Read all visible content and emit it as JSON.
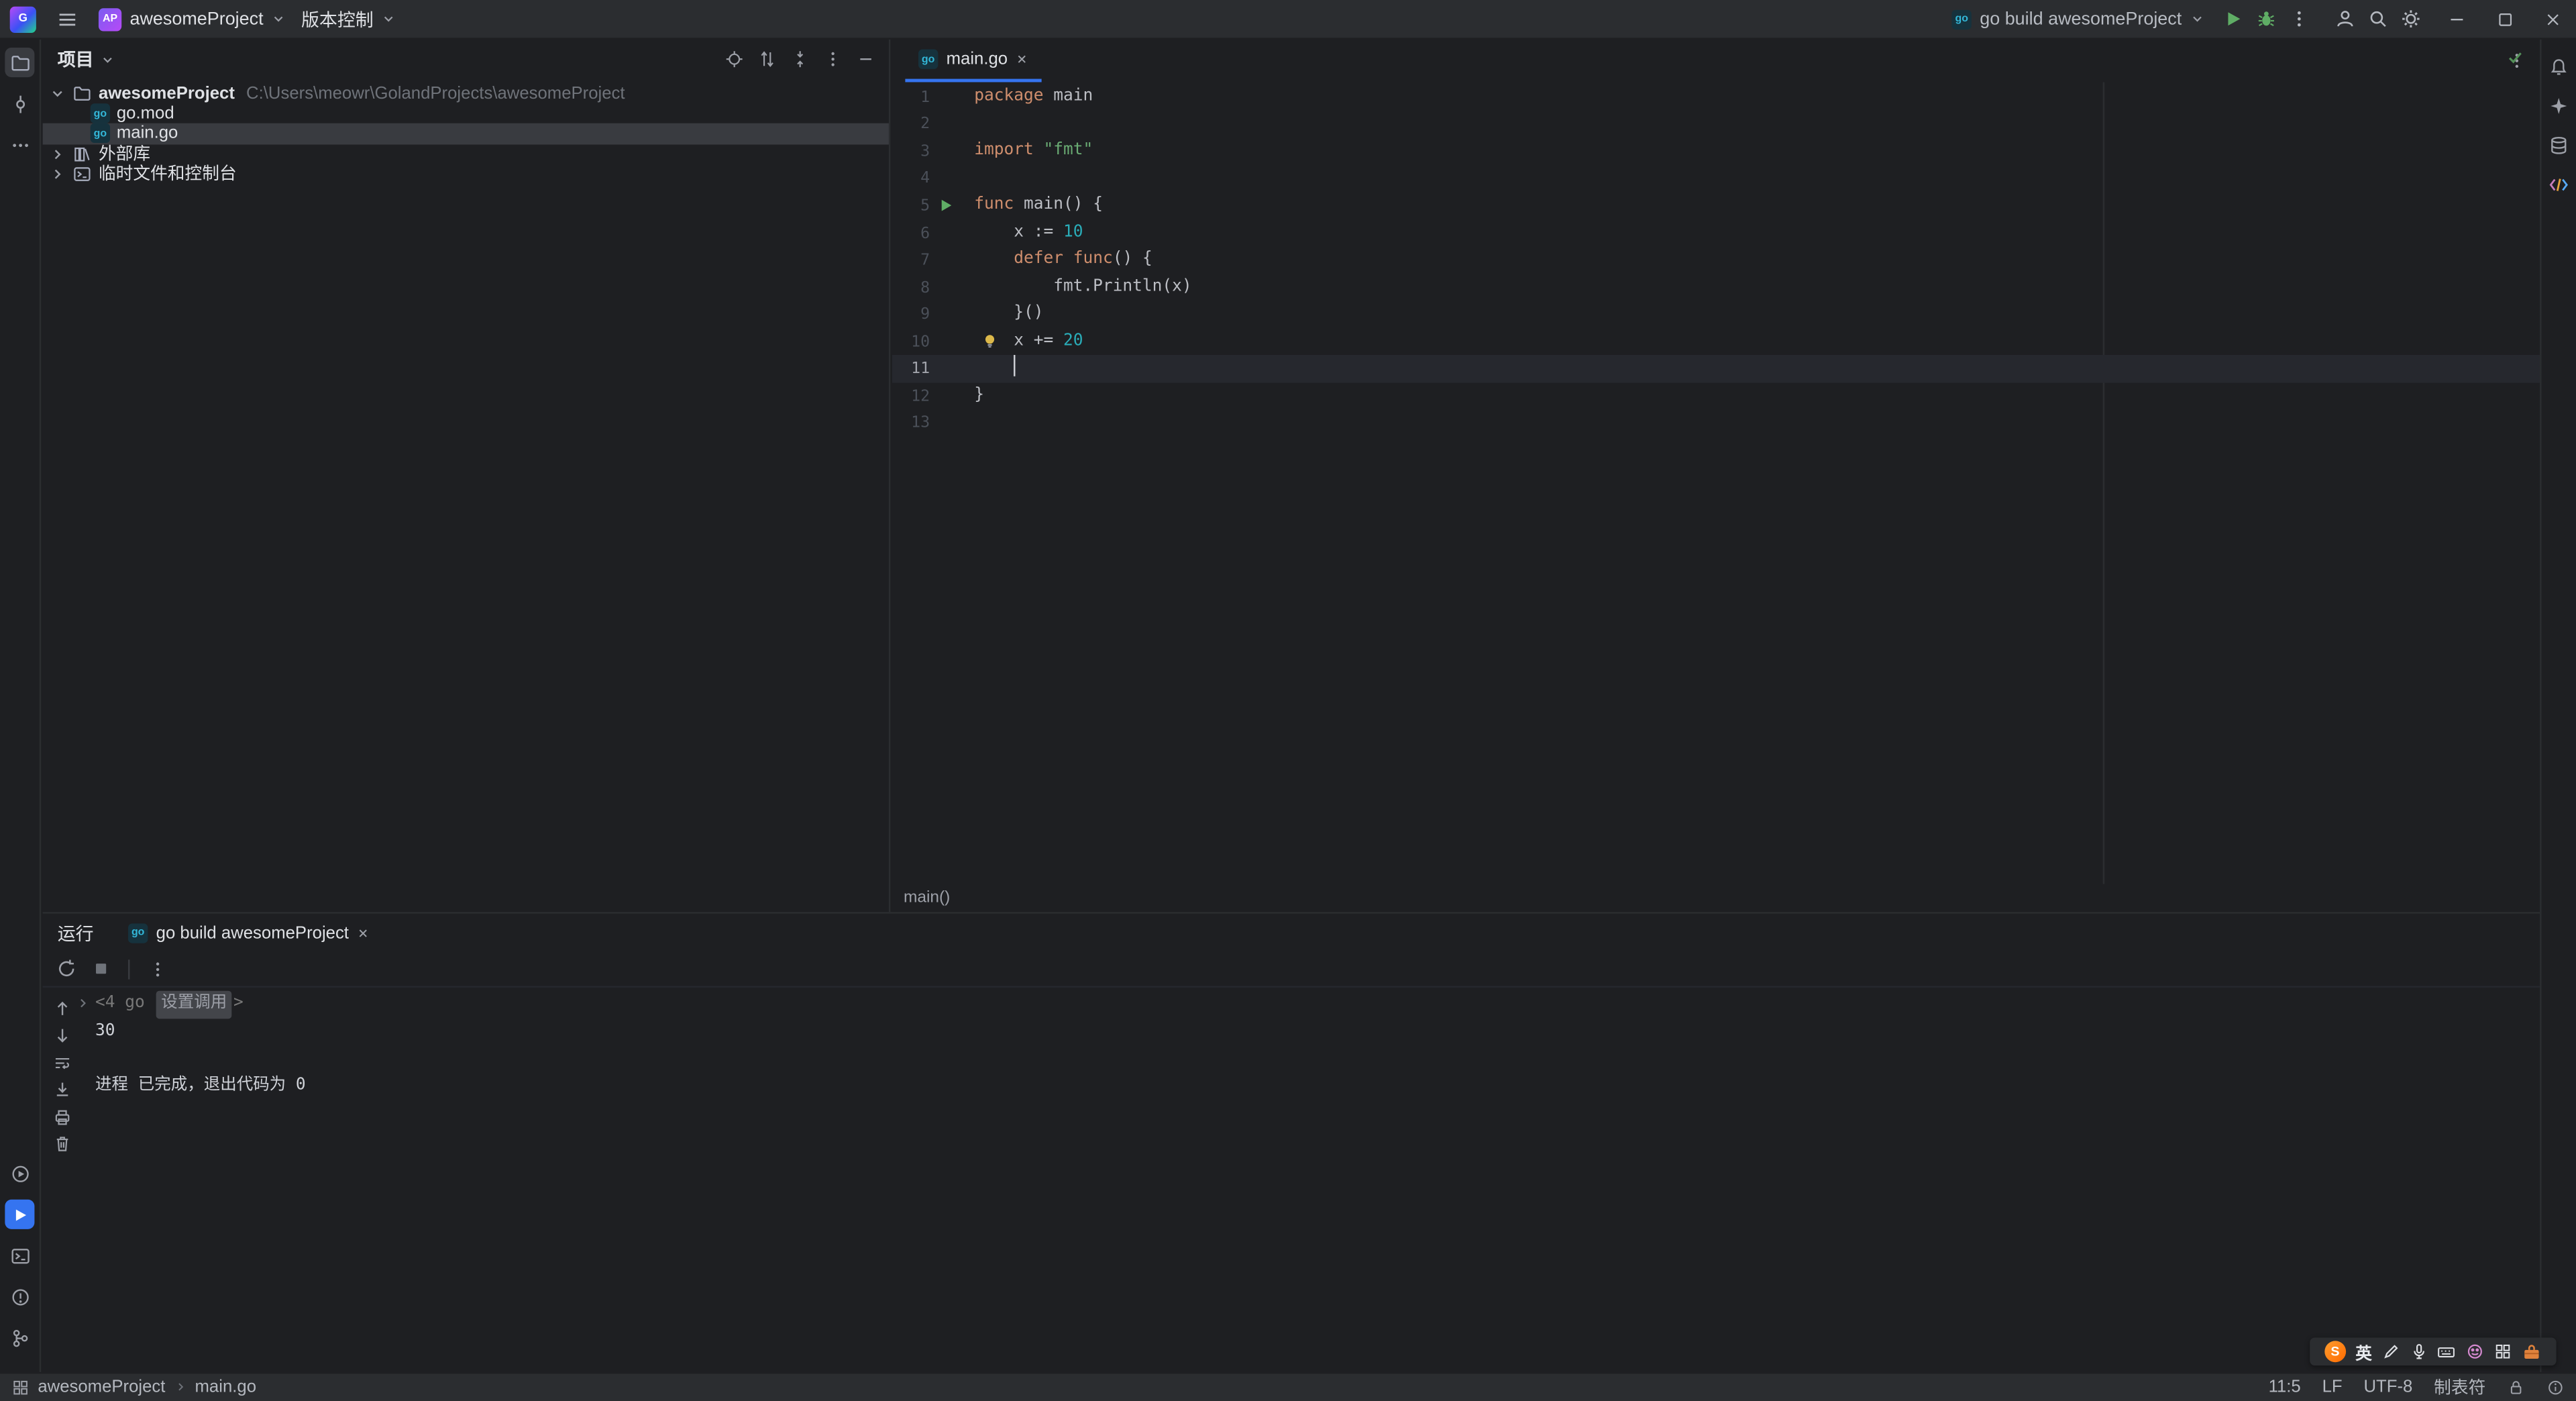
{
  "titlebar": {
    "logo_letter": "G",
    "project_badge": "AP",
    "project_name": "awesomeProject",
    "vcs_label": "版本控制",
    "run_config": "go build awesomeProject"
  },
  "project_panel": {
    "title": "项目",
    "tree": [
      {
        "level": 0,
        "chevron": "down",
        "icon": "folder",
        "label": "awesomeProject",
        "suffix": "C:\\Users\\meowr\\GolandProjects\\awesomeProject",
        "bold": true
      },
      {
        "level": 1,
        "icon": "gomod",
        "label": "go.mod"
      },
      {
        "level": 1,
        "icon": "gofile",
        "label": "main.go",
        "selected": true
      },
      {
        "level": 0,
        "chevron": "right",
        "icon": "lib",
        "label": "外部库"
      },
      {
        "level": 0,
        "chevron": "right",
        "icon": "scratch",
        "label": "临时文件和控制台"
      }
    ]
  },
  "editor": {
    "tab": "main.go",
    "breadcrumb": "main()",
    "lines": [
      {
        "n": 1,
        "seg": [
          [
            "kw",
            "package"
          ],
          [
            "def",
            " main"
          ]
        ]
      },
      {
        "n": 2,
        "seg": []
      },
      {
        "n": 3,
        "seg": [
          [
            "kw",
            "import"
          ],
          [
            "def",
            " "
          ],
          [
            "str",
            "\"fmt\""
          ]
        ]
      },
      {
        "n": 4,
        "seg": []
      },
      {
        "n": 5,
        "run": true,
        "seg": [
          [
            "kw",
            "func"
          ],
          [
            "def",
            " main() {"
          ]
        ]
      },
      {
        "n": 6,
        "seg": [
          [
            "def",
            "    x := "
          ],
          [
            "num",
            "10"
          ]
        ]
      },
      {
        "n": 7,
        "seg": [
          [
            "def",
            "    "
          ],
          [
            "kw",
            "defer"
          ],
          [
            "def",
            " "
          ],
          [
            "kw",
            "func"
          ],
          [
            "def",
            "() {"
          ]
        ]
      },
      {
        "n": 8,
        "seg": [
          [
            "def",
            "        fmt.Println(x)"
          ]
        ]
      },
      {
        "n": 9,
        "seg": [
          [
            "def",
            "    }()"
          ]
        ]
      },
      {
        "n": 10,
        "bulb": true,
        "seg": [
          [
            "def",
            "    x += "
          ],
          [
            "num",
            "20"
          ]
        ]
      },
      {
        "n": 11,
        "current": true,
        "cursor": true,
        "seg": [
          [
            "def",
            "    "
          ]
        ]
      },
      {
        "n": 12,
        "seg": [
          [
            "def",
            "}"
          ]
        ]
      },
      {
        "n": 13,
        "seg": []
      }
    ]
  },
  "run_panel": {
    "title": "运行",
    "tab": "go build awesomeProject",
    "console": [
      {
        "fold": true,
        "seg": [
          [
            "dim",
            "<4 go "
          ],
          [
            "chip",
            "设置调用"
          ],
          [
            "dim",
            ">"
          ]
        ]
      },
      {
        "seg": [
          [
            "out",
            "30"
          ]
        ]
      },
      {
        "seg": []
      },
      {
        "seg": [
          [
            "out",
            "进程 已完成，退出代码为 0"
          ]
        ]
      }
    ]
  },
  "status_bar": {
    "project": "awesomeProject",
    "file": "main.go",
    "cursor": "11:5",
    "line_ending": "LF",
    "encoding": "UTF-8",
    "indent": "制表符"
  },
  "ime": {
    "mode": "英"
  },
  "icons": {
    "titlebar": [
      "goland-logo",
      "main-menu",
      "project-chevron",
      "vcs-chevron",
      "run-config-go",
      "run",
      "debug",
      "more",
      "user",
      "search",
      "settings",
      "minimize",
      "maximize",
      "close"
    ],
    "left_strip": [
      "project-folder",
      "commit",
      "more-tools",
      "services",
      "run",
      "terminal",
      "problems",
      "version-control-branch"
    ],
    "right_strip": [
      "notifications-bell",
      "ai-assistant",
      "database",
      "endpoints-code"
    ],
    "colors": {
      "accent": "#3574f0",
      "run_green": "#5fad65",
      "keyword": "#cf8e6d",
      "string": "#6aab73",
      "number": "#2aacb8",
      "bulb": "#dcb84a"
    }
  }
}
